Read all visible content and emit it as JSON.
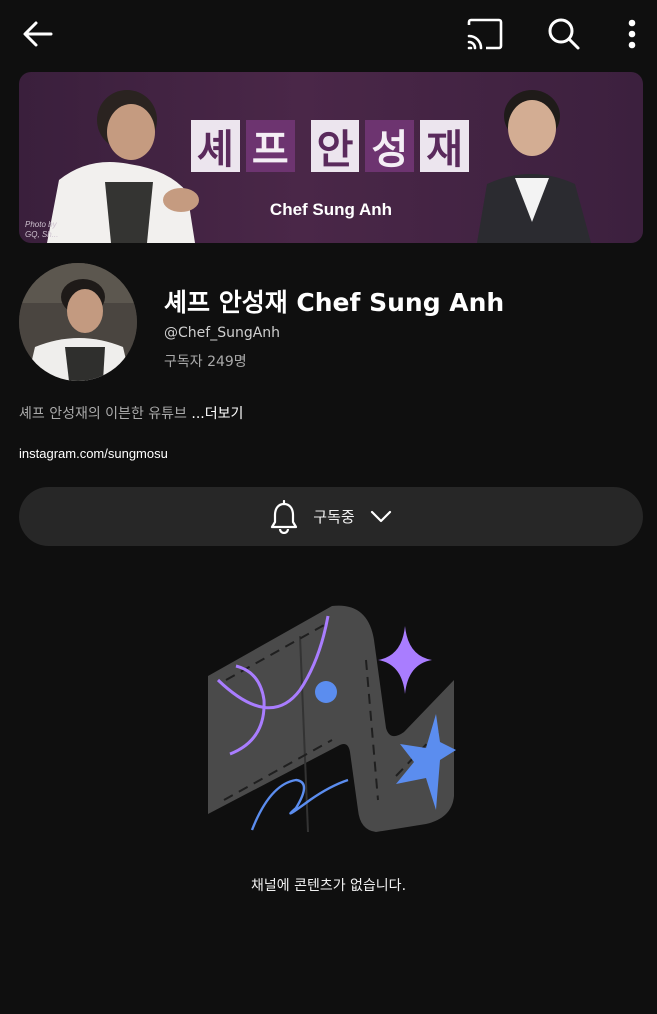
{
  "topbar": {
    "back_icon": "arrow-left-icon",
    "cast_icon": "cast-icon",
    "search_icon": "search-icon",
    "more_icon": "more-vert-icon"
  },
  "banner": {
    "title_tiles": [
      "셰",
      "프",
      "안",
      "성",
      "재"
    ],
    "subtitle": "Chef Sung Anh",
    "credit_line1": "Photo by",
    "credit_line2": "GQ, Sh..."
  },
  "channel": {
    "name": "셰프 안성재 Chef Sung Anh",
    "handle": "@Chef_SungAnh",
    "subscribers": "구독자 249명",
    "description": "셰프 안성재의 이븐한 유튜브 ",
    "more_label": "...더보기",
    "link": "instagram.com/sungmosu"
  },
  "subscribe": {
    "label": "구독중",
    "bell_icon": "bell-icon",
    "chevron_icon": "chevron-down-icon"
  },
  "empty_state": {
    "message": "채널에 콘텐츠가 없습니다."
  },
  "colors": {
    "background": "#0f0f0f",
    "button_bg": "#272727",
    "banner_purple": "#4a2748",
    "accent_purple": "#a97dff",
    "accent_blue": "#5b8def"
  }
}
